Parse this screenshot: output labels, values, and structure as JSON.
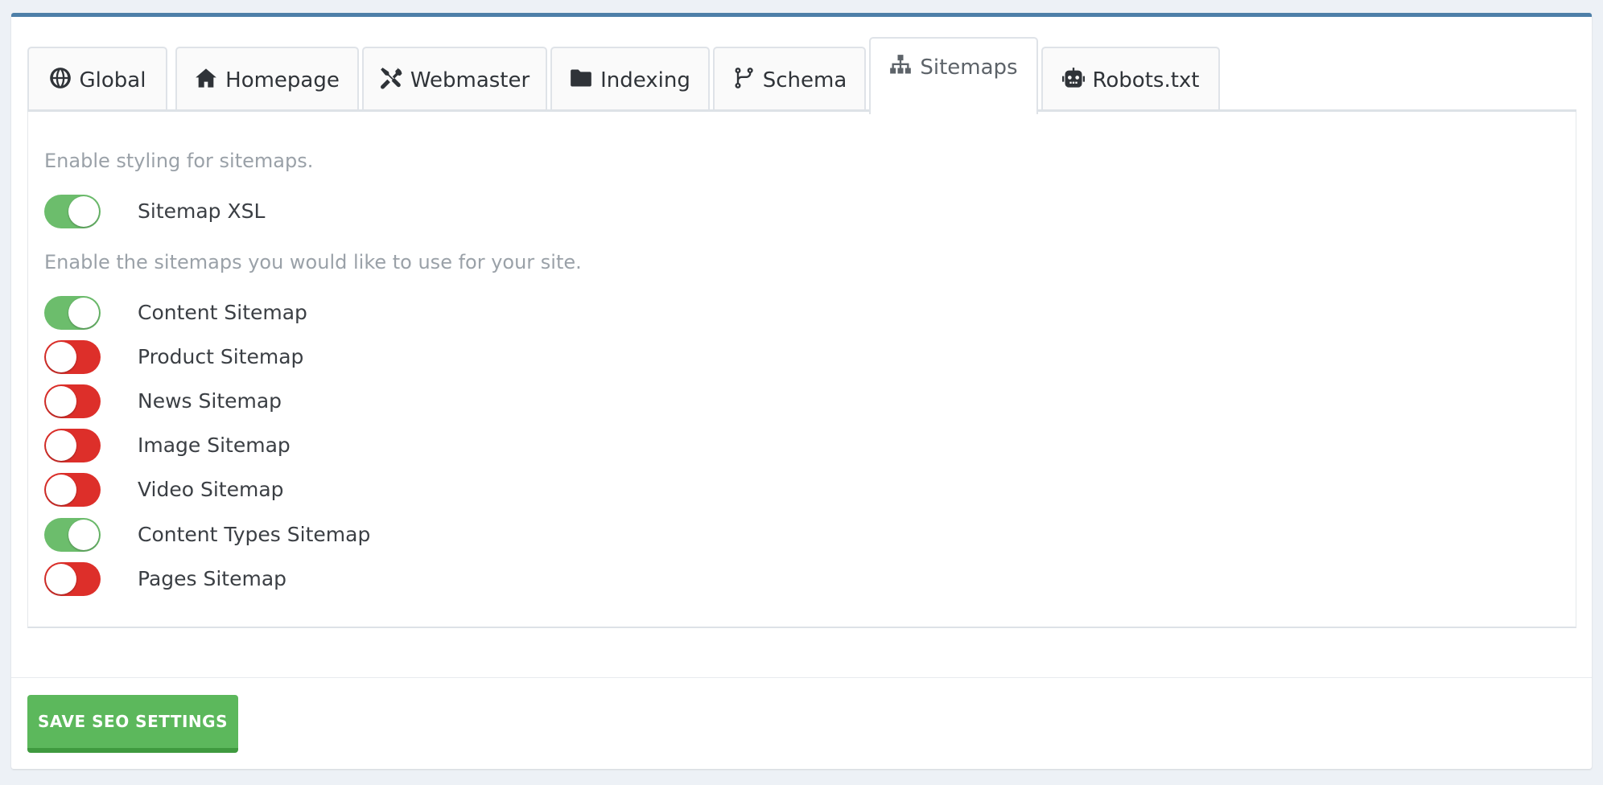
{
  "tabs": [
    {
      "label": "Global",
      "icon": "globe-icon"
    },
    {
      "label": "Homepage",
      "icon": "home-icon"
    },
    {
      "label": "Webmaster",
      "icon": "tools-icon"
    },
    {
      "label": "Indexing",
      "icon": "folder-icon"
    },
    {
      "label": "Schema",
      "icon": "code-branch-icon"
    },
    {
      "label": "Sitemaps",
      "icon": "sitemap-icon",
      "active": true
    },
    {
      "label": "Robots.txt",
      "icon": "robot-icon"
    }
  ],
  "sitemaps": {
    "styling_description": "Enable styling for sitemaps.",
    "styling_toggle": {
      "label": "Sitemap XSL",
      "enabled": true
    },
    "enable_description": "Enable the sitemaps you would like to use for your site.",
    "toggles": [
      {
        "label": "Content Sitemap",
        "enabled": true
      },
      {
        "label": "Product Sitemap",
        "enabled": false
      },
      {
        "label": "News Sitemap",
        "enabled": false
      },
      {
        "label": "Image Sitemap",
        "enabled": false
      },
      {
        "label": "Video Sitemap",
        "enabled": false
      },
      {
        "label": "Content Types Sitemap",
        "enabled": true
      },
      {
        "label": "Pages Sitemap",
        "enabled": false
      }
    ]
  },
  "save_button": {
    "label": "SAVE SEO SETTINGS"
  },
  "colors": {
    "accent_bar": "#4d7fa8",
    "toggle_on": "#6cbd6c",
    "toggle_off": "#dd2f2a",
    "save_button": "#5cb85c"
  }
}
